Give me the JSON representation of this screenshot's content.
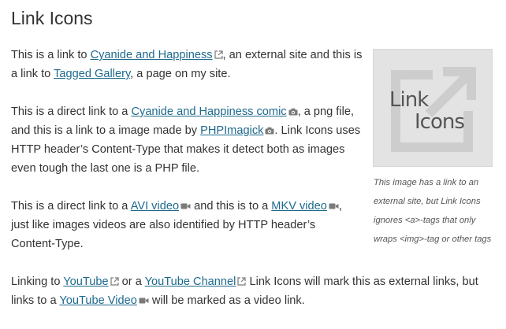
{
  "page": {
    "title": "Link Icons"
  },
  "paragraph1": {
    "t1": "This is a link to ",
    "link1": "Cyanide and Happiness",
    "t2": ", an external site and this is a link to ",
    "link2": "Tagged Gallery",
    "t3": ", a page on my site."
  },
  "paragraph2": {
    "t1": "This is a direct link to a ",
    "link1": "Cyanide and Happiness comic",
    "t2": ", a png file, and this is a link to a image made by ",
    "link2": "PHPImagick",
    "t3": ". Link Icons uses HTTP header’s Content-Type that makes it detect both as images even tough the last one is a PHP file."
  },
  "paragraph3": {
    "t1": "This is a direct link to a ",
    "link1": "AVI video",
    "t2": " and this is to a ",
    "link2": "MKV video",
    "t3": ", just like images videos are also identified by HTTP header’s Content-Type."
  },
  "paragraph4": {
    "t1": "Linking to ",
    "link1": "YouTube",
    "t2": " or a ",
    "link2": "YouTube Channel",
    "t3": " Link Icons will mark this as external links, but links to a ",
    "link3": "YouTube Video",
    "t4": " will be marked as a video link."
  },
  "figure": {
    "logo_text_line1": "Link",
    "logo_text_line2": "Icons",
    "caption": "This image has a link to an external site, but Link Icons ignores <a>-tags that only wraps <img>-tag or other tags"
  },
  "icons": {
    "external": "external-link-icon",
    "image": "camera-icon",
    "video": "video-camera-icon"
  },
  "colors": {
    "link": "#1e6a8d",
    "text": "#333333",
    "figure_bg": "#e3e3e3"
  }
}
